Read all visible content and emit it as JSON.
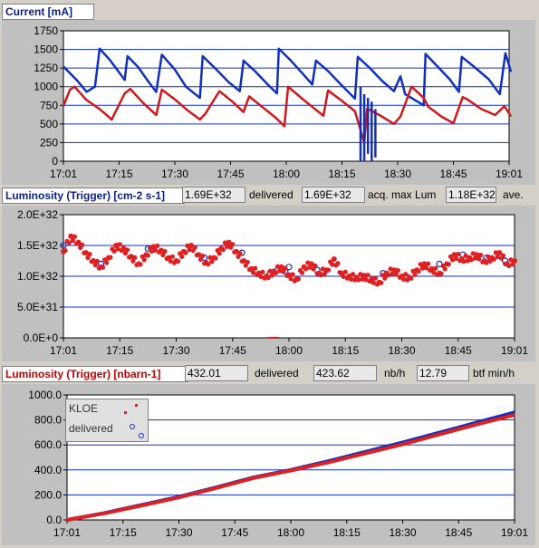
{
  "panel1": {
    "title": "Current [mA]",
    "chart_data": {
      "type": "line",
      "ylim": [
        0,
        1750
      ],
      "yticks": [
        "1750",
        "1500",
        "1250",
        "1000",
        "750",
        "500",
        "250",
        "0"
      ],
      "xticks": [
        "17:01",
        "17:15",
        "17:30",
        "17:45",
        "18:00",
        "18:15",
        "18:30",
        "18:45",
        "19:01"
      ],
      "series": [
        {
          "color": "#1030c0",
          "x": [
            0,
            1.5,
            2.5,
            3.4,
            3.9,
            5,
            6.6,
            6.9,
            8,
            9.2,
            10,
            10.6,
            12,
            13.2,
            14.7,
            15,
            16.4,
            17.8,
            19,
            19.4,
            20.7,
            22,
            23,
            23.2,
            24.5,
            25.8,
            26.8,
            27.2,
            28.5,
            29.8,
            31.4,
            31.7,
            33,
            34.3,
            35.6,
            36.3,
            36.8,
            38.8,
            39,
            40.3,
            41.6,
            42.6,
            42.9,
            44.2,
            45.8,
            47,
            47.6,
            48.2
          ],
          "y": [
            1270,
            1080,
            930,
            1000,
            1510,
            1360,
            1090,
            1410,
            1270,
            1060,
            930,
            1430,
            1230,
            1000,
            850,
            1410,
            1240,
            1060,
            940,
            1350,
            1200,
            1030,
            910,
            1510,
            1350,
            1170,
            1030,
            1350,
            1210,
            1040,
            840,
            1400,
            1250,
            1080,
            940,
            1140,
            900,
            750,
            1440,
            1270,
            1100,
            930,
            1400,
            1270,
            1100,
            900,
            1450,
            1200
          ]
        },
        {
          "color": "#d01818",
          "x": [
            0,
            0.7,
            1.2,
            2.5,
            3.9,
            5.2,
            6.6,
            7.2,
            8.6,
            10,
            10.6,
            12,
            13.4,
            14.7,
            15.3,
            16.8,
            18.2,
            19.4,
            20,
            21.4,
            22.8,
            23.8,
            24.2,
            25.7,
            27,
            28,
            28.5,
            30,
            31.4,
            32.4,
            32.7,
            33,
            34.3,
            35.6,
            36.3,
            37.5,
            38.8,
            39.3,
            40.7,
            42,
            43,
            43.5,
            45,
            46.5,
            47.5,
            48.2
          ],
          "y": [
            740,
            960,
            1000,
            820,
            700,
            560,
            910,
            970,
            780,
            620,
            960,
            830,
            680,
            560,
            640,
            940,
            800,
            660,
            870,
            730,
            590,
            470,
            1000,
            840,
            710,
            610,
            950,
            810,
            670,
            250,
            700,
            690,
            600,
            500,
            600,
            1000,
            850,
            730,
            600,
            510,
            860,
            830,
            700,
            620,
            740,
            600
          ]
        }
      ]
    }
  },
  "panel2": {
    "title": "Luminosity (Trigger) [cm-2 s-1]",
    "delivered_label": "delivered",
    "acq_label": "acq. max Lum",
    "ave_label": "ave.",
    "value1": "1.69E+32",
    "value2": "1.69E+32",
    "value3": "1.18E+32",
    "chart_data": {
      "type": "scatter",
      "ylim": [
        0,
        2e+32
      ],
      "yticks": [
        "2.0E+32",
        "1.5E+32",
        "1.0E+32",
        "5.0E+31",
        "0.0E+0"
      ],
      "xticks": [
        "17:01",
        "17:15",
        "17:30",
        "17:45",
        "18:00",
        "18:15",
        "18:30",
        "18:45",
        "19:01"
      ],
      "series": [
        {
          "color": "#1030c0",
          "x": [
            0,
            4,
            9,
            15,
            19,
            22,
            22.8,
            23.2,
            23.6,
            24.0,
            27,
            32,
            34,
            36.5,
            40,
            42.5,
            45,
            47
          ],
          "y": [
            1.5e+32,
            1.2e+32,
            1.45e+32,
            1.3e+32,
            1.38e+32,
            1.05e+32,
            1.1e+32,
            1.12e+32,
            1.08e+32,
            1.15e+32,
            1.1e+32,
            1e+32,
            1.05e+32,
            1e+32,
            1.2e+32,
            1.35e+32,
            1.3e+32,
            1.25e+32
          ]
        },
        {
          "color": "#e02020",
          "x": [
            0,
            0.8,
            1.6,
            2.4,
            3.2,
            4.0,
            4.8,
            5.6,
            6.4,
            7.2,
            8.0,
            8.8,
            9.6,
            10.4,
            11.2,
            12.0,
            12.8,
            13.6,
            14.4,
            15.2,
            16.0,
            16.8,
            17.6,
            18.4,
            19.2,
            20.0,
            20.8,
            21.6,
            22.4,
            23.2,
            24.0,
            24.8,
            25.6,
            26.4,
            27.2,
            28.0,
            28.8,
            29.6,
            30.4,
            31.2,
            32.0,
            32.8,
            33.6,
            34.4,
            35.2,
            36.0,
            36.8,
            37.6,
            38.4,
            39.2,
            40.0,
            40.8,
            41.6,
            42.4,
            43.2,
            44.0,
            44.8,
            45.6,
            46.4,
            47.2,
            48.0
          ],
          "y": [
            1.4e+32,
            1.65e+32,
            1.55e+32,
            1.38e+32,
            1.25e+32,
            1.15e+32,
            1.3e+32,
            1.5e+32,
            1.45e+32,
            1.32e+32,
            1.2e+32,
            1.35e+32,
            1.48e+32,
            1.42e+32,
            1.3e+32,
            1.25e+32,
            1.4e+32,
            1.5e+32,
            1.35e+32,
            1.22e+32,
            1.3e+32,
            1.45e+32,
            1.55e+32,
            1.4e+32,
            1.25e+32,
            1.12e+32,
            1.05e+32,
            1e+32,
            1.08e+32,
            1.15e+32,
            1.02e+32,
            9.5e+31,
            1.15e+32,
            1.2e+32,
            1.05e+32,
            1.1e+32,
            1.28e+32,
            1.05e+32,
            1e+32,
            9.8e+31,
            1e+32,
            9.5e+31,
            9e+31,
            1.05e+32,
            1.1e+32,
            1e+32,
            9.8e+31,
            1.1e+32,
            1.2e+32,
            1.12e+32,
            1.05e+32,
            1.2e+32,
            1.35e+32,
            1.28e+32,
            1.3e+32,
            1.35e+32,
            1.25e+32,
            1.3e+32,
            1.38e+32,
            1.2e+32,
            1.25e+32
          ]
        }
      ]
    }
  },
  "panel3": {
    "title": "Luminosity (Trigger) [nbarn-1]",
    "delivered_label": "delivered",
    "nbh_label": "nb/h",
    "btf_label": "btf min/h",
    "value1": "432.01",
    "value2": "423.62",
    "value3": "12.79",
    "legend": {
      "kloe": "KLOE",
      "delivered": "delivered"
    },
    "chart_data": {
      "type": "line",
      "ylim": [
        0,
        1000
      ],
      "yticks": [
        "1000.0",
        "800.0",
        "600.0",
        "400.0",
        "200.0",
        "0.0"
      ],
      "xticks": [
        "17:01",
        "17:15",
        "17:30",
        "17:45",
        "18:00",
        "18:15",
        "18:30",
        "18:45",
        "19:01"
      ],
      "series": [
        {
          "name": "delivered",
          "color": "#1030c0",
          "x": [
            0,
            4,
            8,
            12,
            16,
            20,
            24,
            28,
            32,
            36,
            40,
            44,
            48
          ],
          "y": [
            0,
            55,
            120,
            185,
            260,
            340,
            400,
            470,
            545,
            620,
            700,
            780,
            860
          ]
        },
        {
          "name": "KLOE",
          "color": "#e02020",
          "x": [
            0,
            4,
            8,
            12,
            16,
            20,
            24,
            28,
            32,
            36,
            40,
            44,
            48
          ],
          "y": [
            0,
            52,
            115,
            180,
            255,
            335,
            395,
            460,
            532,
            605,
            685,
            765,
            840
          ]
        }
      ]
    }
  }
}
